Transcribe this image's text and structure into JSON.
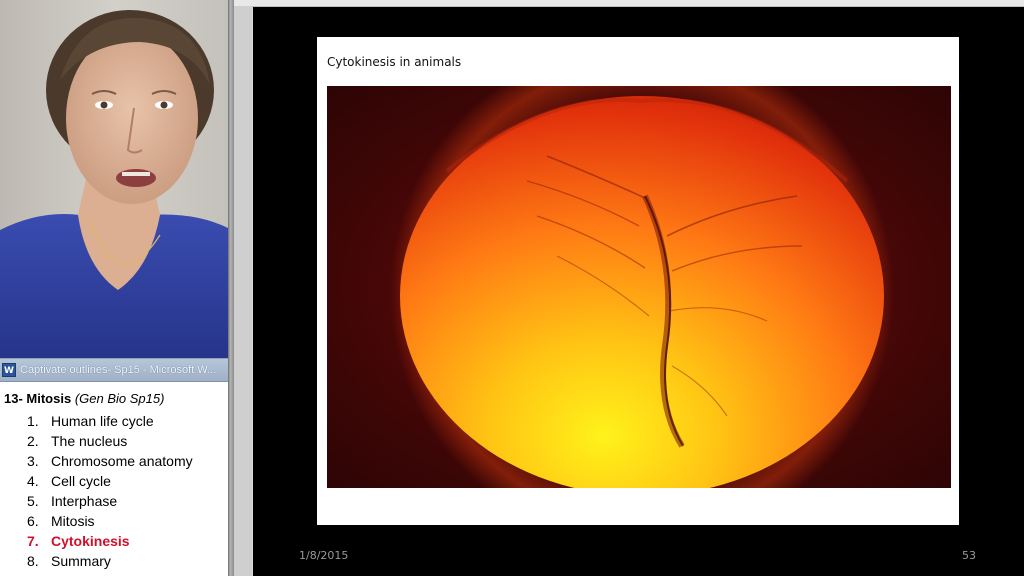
{
  "word_window": {
    "title": "Captivate outlines- Sp15 - Microsoft W...",
    "icon": "word-doc-icon"
  },
  "outline": {
    "heading_bold": "13- Mitosis",
    "heading_italic": "(Gen Bio Sp15)",
    "items": [
      {
        "num": "1.",
        "label": "Human life cycle"
      },
      {
        "num": "2.",
        "label": "The nucleus"
      },
      {
        "num": "3.",
        "label": "Chromosome anatomy"
      },
      {
        "num": "4.",
        "label": "Cell cycle"
      },
      {
        "num": "5.",
        "label": "Interphase"
      },
      {
        "num": "6.",
        "label": "Mitosis"
      },
      {
        "num": "7.",
        "label": "Cytokinesis"
      },
      {
        "num": "8.",
        "label": "Summary"
      }
    ],
    "active_index": 6,
    "active_color": "#d0102a"
  },
  "slide": {
    "title": "Cytokinesis in animals",
    "date": "1/8/2015",
    "number": "53"
  }
}
